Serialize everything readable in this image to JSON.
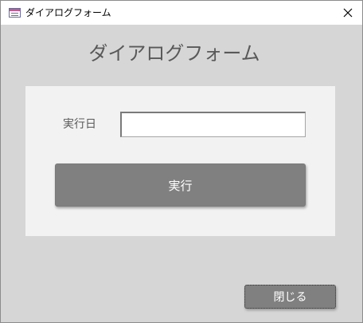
{
  "window": {
    "title": "ダイアログフォーム",
    "icon": "form-icon",
    "close_glyph": "close-icon"
  },
  "form": {
    "heading": "ダイアログフォーム",
    "date_label": "実行日",
    "date_value": "",
    "run_button_label": "実行",
    "close_button_label": "閉じる"
  },
  "colors": {
    "window_background": "#d6d6d6",
    "panel_background": "#f2f2f2",
    "button_background": "#808080",
    "heading_text": "#595959"
  }
}
